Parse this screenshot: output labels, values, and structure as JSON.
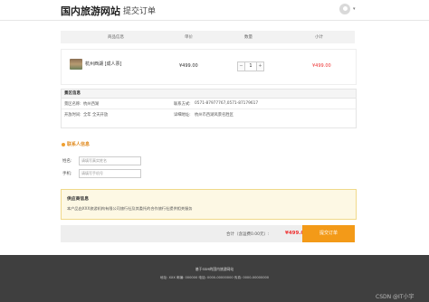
{
  "header": {
    "site_title": "国内旅游网站",
    "page_title": "提交订单",
    "chevron": "▾"
  },
  "cart": {
    "columns": [
      "商品信息",
      "单价",
      "数量",
      "小计"
    ],
    "product_name": "杭州西湖 [成人票]",
    "unit_price": "¥499.00",
    "quantity": "1",
    "minus": "−",
    "plus": "+",
    "subtotal": "¥499.00"
  },
  "scenic": {
    "title": "景区信息",
    "name_label": "景区名称:",
    "name_value": "杭州西湖",
    "phone_label": "联系方式:",
    "phone_value": "0571-87977767,0571-87179617",
    "hours_label": "开放时间:",
    "hours_value": "全年 全天开放",
    "address_label": "详细地址:",
    "address_value": "杭州市西湖风景名胜区"
  },
  "contact": {
    "title": "联系人信息",
    "name_label": "姓名:",
    "name_placeholder": "请填写真实姓名",
    "phone_label": "手机:",
    "phone_placeholder": "请填写手机号"
  },
  "supplier": {
    "title": "供应商信息",
    "text": "本产品由XXX旅游机构有限公司旅行社及其委托的合作旅行社提供相关服务"
  },
  "total": {
    "label": "合计（含运费0.00元）:",
    "amount": "¥499.00",
    "submit_label": "提交订单"
  },
  "footer": {
    "line1": "基于SSM的国内旅游网站",
    "line2": "地址: XXX    邮编: 000000    电话: 0000-00000000    传真: 0000-00000000"
  },
  "watermark": "CSDN @IT小宇"
}
